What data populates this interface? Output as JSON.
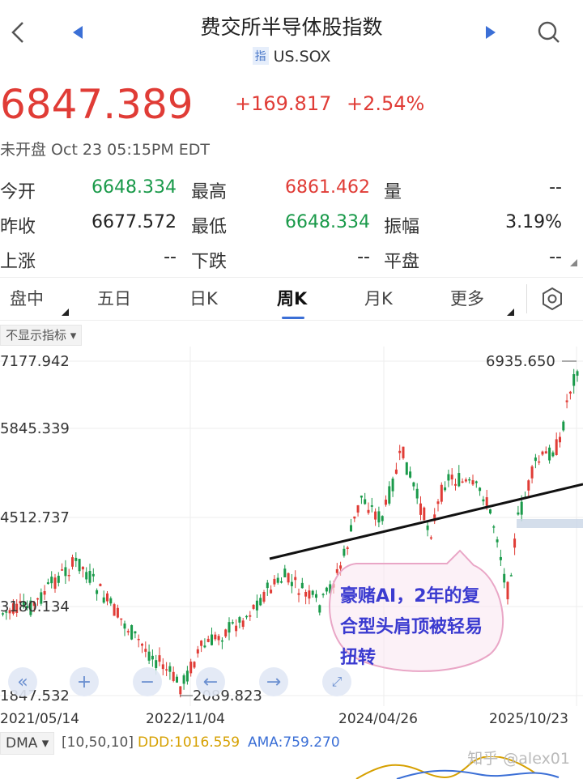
{
  "header": {
    "title": "费交所半导体股指数",
    "tag": "指",
    "symbol": "US.SOX"
  },
  "quote": {
    "price": "6847.389",
    "change": "+169.817",
    "change_pct": "+2.54%",
    "status": "未开盘 Oct 23 05:15PM EDT",
    "color_up": "#e03c36",
    "color_down": "#1a9a4a"
  },
  "stats": [
    {
      "label": "今开",
      "value": "6648.334",
      "color": "green"
    },
    {
      "label": "最高",
      "value": "6861.462",
      "color": "red"
    },
    {
      "label": "量",
      "value": "--",
      "color": "black"
    },
    {
      "label": "昨收",
      "value": "6677.572",
      "color": "black"
    },
    {
      "label": "最低",
      "value": "6648.334",
      "color": "green"
    },
    {
      "label": "振幅",
      "value": "3.19%",
      "color": "black"
    },
    {
      "label": "上涨",
      "value": "--",
      "color": "black"
    },
    {
      "label": "下跌",
      "value": "--",
      "color": "black"
    },
    {
      "label": "平盘",
      "value": "--",
      "color": "black"
    }
  ],
  "tabs": [
    "盘中",
    "五日",
    "日K",
    "周K",
    "月K",
    "更多"
  ],
  "active_tab": "周K",
  "indicator_button": "不显示指标 ▾",
  "chart_data": {
    "type": "candlestick",
    "y_tick_labels": [
      "7177.942",
      "5845.339",
      "4512.737",
      "3180.134",
      "1847.532"
    ],
    "x_tick_labels": [
      "2021/05/14",
      "2022/11/04",
      "2024/04/26",
      "2025/10/23"
    ],
    "max_label": "6935.650",
    "min_label": "2089.823",
    "ylim": [
      1847.532,
      7177.942
    ],
    "annotation": "豪赌AI，2年的复合型头肩顶被轻易扭转",
    "trendline": "neckline"
  },
  "indicators": {
    "name": "DMA ▾",
    "params": "[10,50,10]",
    "ddd": "DDD:1016.559",
    "ama": "AMA:759.270"
  },
  "watermark": "知乎 @alex01"
}
